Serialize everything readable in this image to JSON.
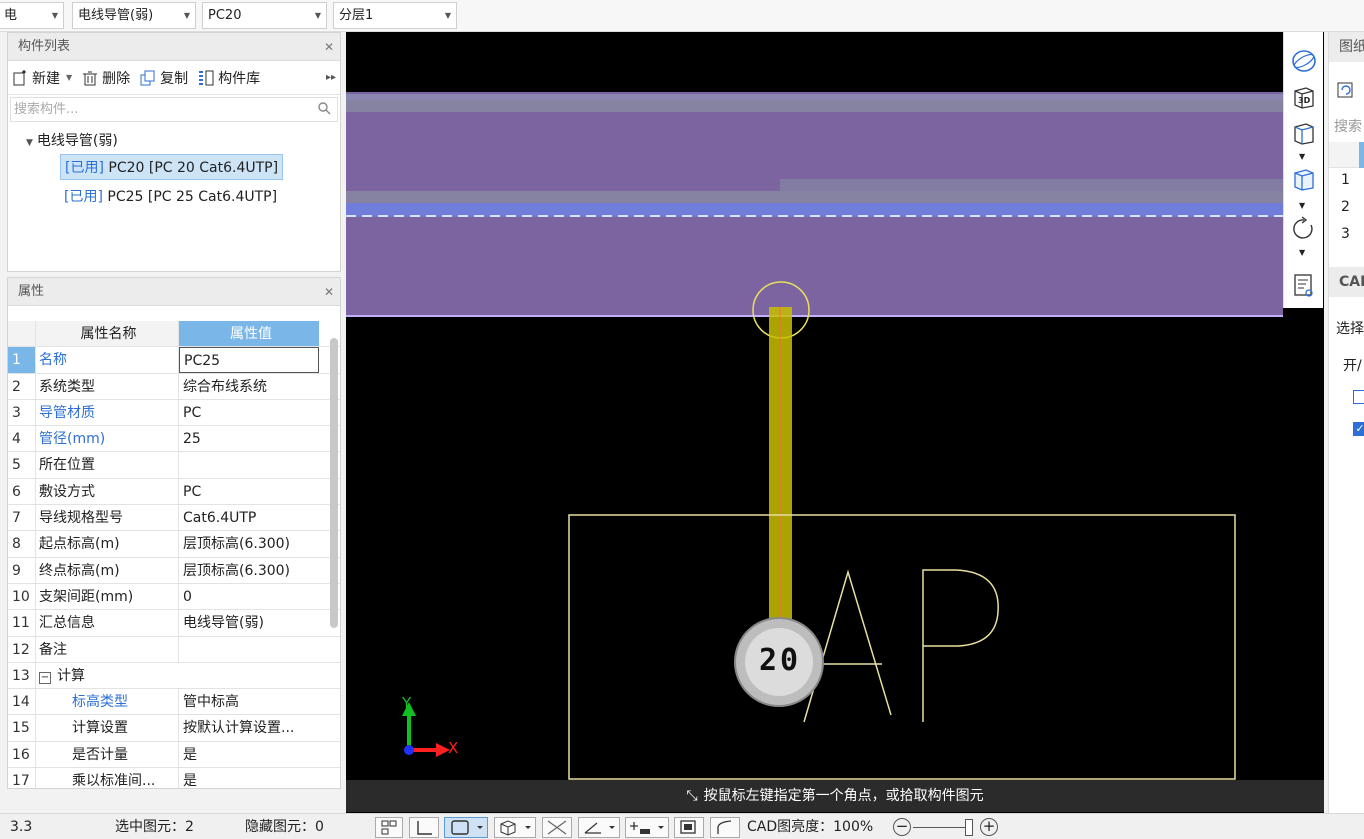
{
  "topbar": {
    "combo1": "电",
    "combo2": "电线导管(弱)",
    "combo3": "PC20",
    "combo4": "分层1"
  },
  "component_panel": {
    "title": "构件列表",
    "toolbar": {
      "new_label": "新建",
      "delete_label": "删除",
      "copy_label": "复制",
      "library_label": "构件库"
    },
    "search_placeholder": "搜索构件...",
    "tree_root": "电线导管(弱)",
    "items": [
      {
        "tag": "[已用]",
        "label": "PC20 [PC 20 Cat6.4UTP]"
      },
      {
        "tag": "[已用]",
        "label": "PC25 [PC 25 Cat6.4UTP]"
      }
    ]
  },
  "property_panel": {
    "title": "属性",
    "col_name": "属性名称",
    "col_value": "属性值",
    "rows": [
      {
        "n": "1",
        "name": "名称",
        "value": "PC25"
      },
      {
        "n": "2",
        "name": "系统类型",
        "value": "综合布线系统"
      },
      {
        "n": "3",
        "name": "导管材质",
        "value": "PC"
      },
      {
        "n": "4",
        "name": "管径(mm)",
        "value": "25"
      },
      {
        "n": "5",
        "name": "所在位置",
        "value": ""
      },
      {
        "n": "6",
        "name": "敷设方式",
        "value": "PC"
      },
      {
        "n": "7",
        "name": "导线规格型号",
        "value": "Cat6.4UTP"
      },
      {
        "n": "8",
        "name": "起点标高(m)",
        "value": "层顶标高(6.300)"
      },
      {
        "n": "9",
        "name": "终点标高(m)",
        "value": "层顶标高(6.300)"
      },
      {
        "n": "10",
        "name": "支架间距(mm)",
        "value": "0"
      },
      {
        "n": "11",
        "name": "汇总信息",
        "value": "电线导管(弱)"
      },
      {
        "n": "12",
        "name": "备注",
        "value": ""
      },
      {
        "n": "13",
        "name": "计算",
        "value": ""
      },
      {
        "n": "14",
        "name": "标高类型",
        "value": "管中标高"
      },
      {
        "n": "15",
        "name": "计算设置",
        "value": "按默认计算设置..."
      },
      {
        "n": "16",
        "name": "是否计量",
        "value": "是"
      },
      {
        "n": "17",
        "name": "乘以标准间...",
        "value": "是"
      }
    ]
  },
  "canvas": {
    "label_20": "20",
    "label_ap": "AP",
    "axis_x": "X",
    "axis_y": "Y",
    "hint": "按鼠标左键指定第一个角点，或拾取构件图元"
  },
  "view_toolbar": {
    "label_3d": "3D"
  },
  "right_panel": {
    "title1": "图纸",
    "search": "搜索",
    "rows": [
      "1",
      "2",
      "3"
    ],
    "title2": "CAD",
    "select": "选择",
    "open": "开/"
  },
  "status": {
    "coord": "3.3",
    "selected": "选中图元：2",
    "hidden": "隐藏图元：0",
    "cad_brightness": "CAD图亮度：100%"
  },
  "colors": {
    "purple_band": "#7b64a0",
    "yellow": "#f0e060",
    "accent_blue": "#2d6fd6",
    "header_blue": "#7ab7e8"
  }
}
